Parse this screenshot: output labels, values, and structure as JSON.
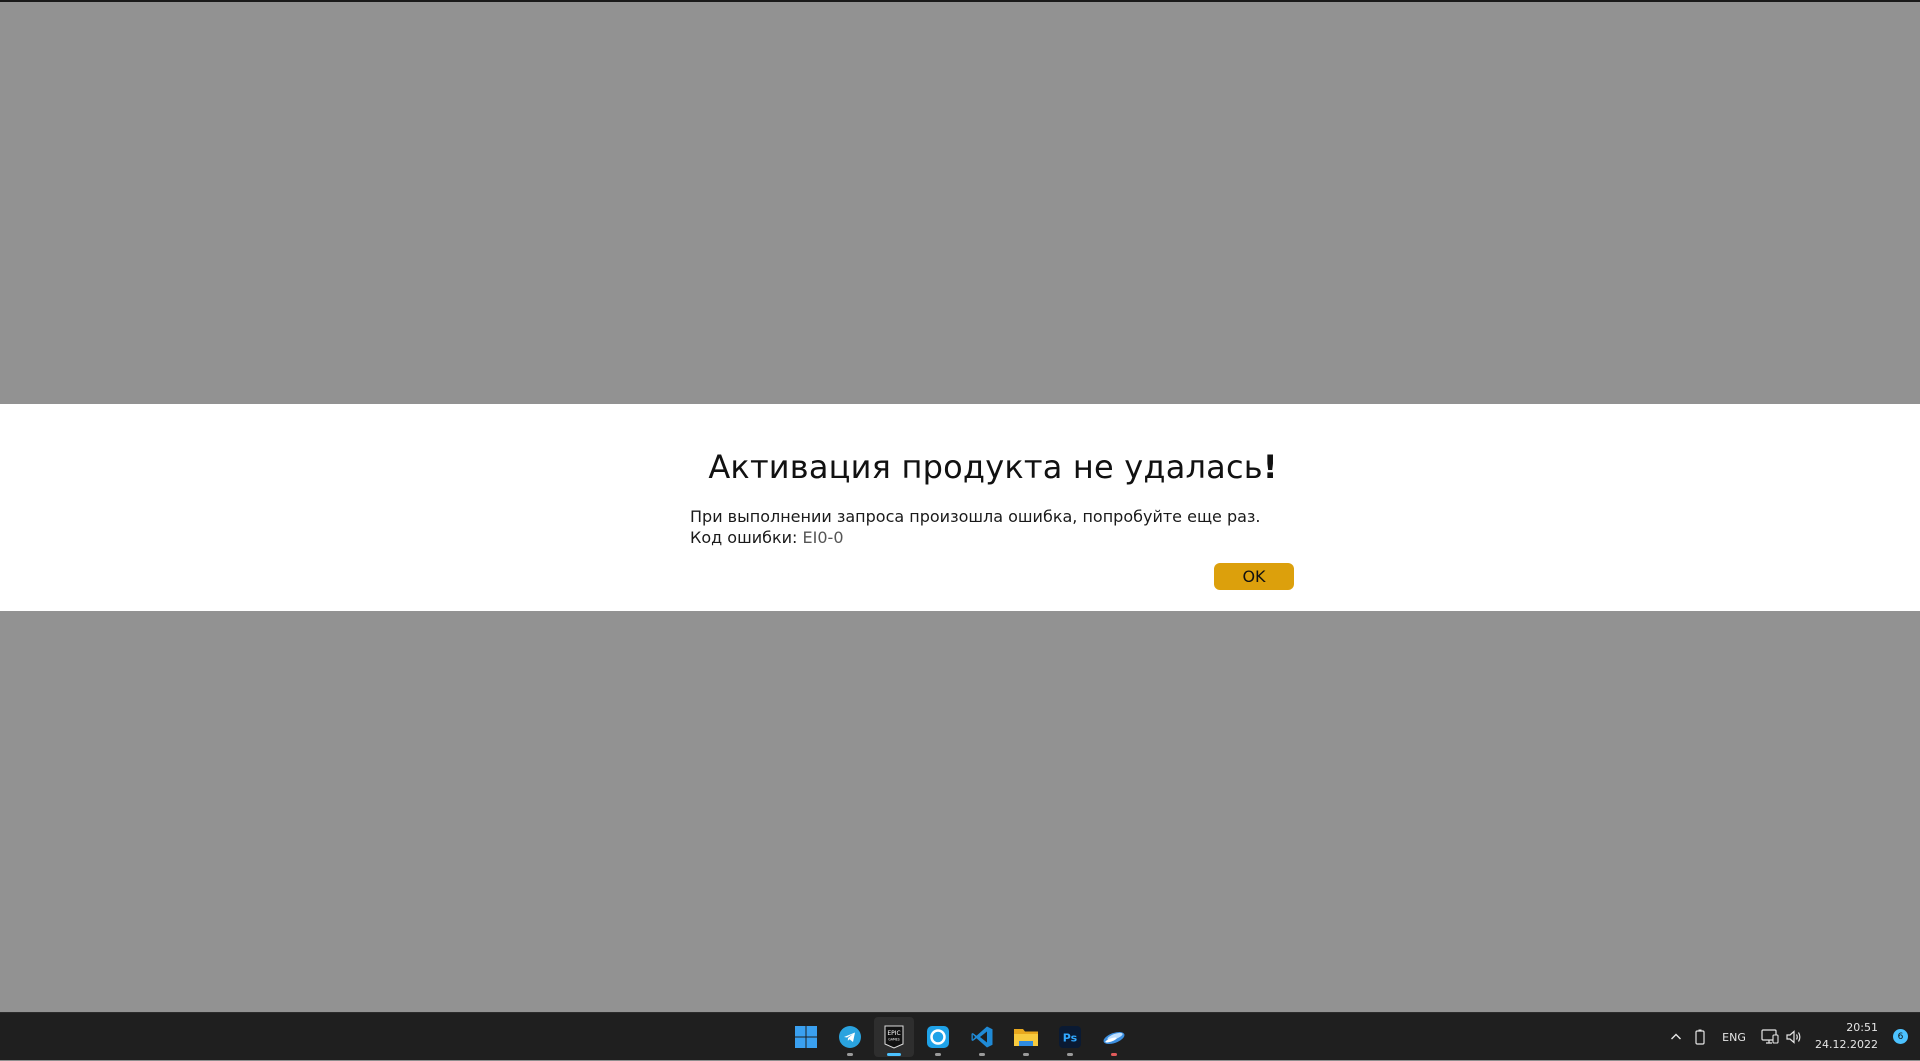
{
  "dialog": {
    "title": "Активация продукта не удалась",
    "title_exclamation": "!",
    "message_line1": "При выполнении запроса произошла ошибка, попробуйте еще раз.",
    "error_code_label": "Код ошибки:",
    "error_code_value": "EI0-0",
    "ok_label": "OK",
    "ok_color": "#dca00c"
  },
  "taskbar": {
    "apps": [
      {
        "name": "start",
        "icon": "windows-start-icon"
      },
      {
        "name": "telegram",
        "icon": "telegram-icon"
      },
      {
        "name": "epic-games",
        "icon": "epic-games-icon",
        "icon_text_top": "EPIC",
        "icon_text_bottom": "GAMES",
        "active": true
      },
      {
        "name": "app-blue-circle",
        "icon": "circle-app-icon"
      },
      {
        "name": "vscode",
        "icon": "vscode-icon"
      },
      {
        "name": "file-explorer",
        "icon": "folder-icon"
      },
      {
        "name": "photoshop",
        "icon": "photoshop-icon",
        "icon_text": "Ps"
      },
      {
        "name": "app-swoosh",
        "icon": "swoosh-app-icon"
      }
    ],
    "tray": {
      "language": "ENG",
      "time": "20:51",
      "date": "24.12.2022",
      "notification_count": "6"
    }
  }
}
